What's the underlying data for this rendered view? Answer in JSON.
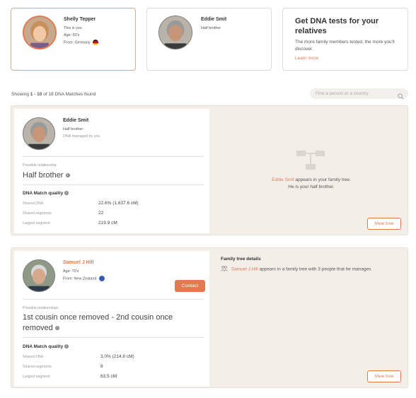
{
  "top_cards": {
    "me": {
      "name": "Shelly Tepper",
      "note": "This is you",
      "age": "Age: 50's",
      "from_label": "From:",
      "from_value": "Germany",
      "flag_icon": "germany-flag-icon"
    },
    "relative": {
      "name": "Eddie Smit",
      "relation": "Half brother"
    },
    "promo": {
      "title": "Get DNA tests for your relatives",
      "text": "The more family members tested, the more you'll discover.",
      "link": "Learn more"
    }
  },
  "results": {
    "showing_prefix": "Showing",
    "range": "1 - 10",
    "of_text": "of 18 DNA Matches found",
    "search_placeholder": "Find a person or a country"
  },
  "matches": [
    {
      "name": "Eddie Smit",
      "line1": "Half brother",
      "line2": "DNA managed by you",
      "relationship_label": "Possible relationship",
      "relationship": "Half brother",
      "quality_title": "DNA Match quality",
      "shared_dna_label": "Shared DNA",
      "shared_dna": "22.6% (1,637.6 cM)",
      "shared_segments_label": "Shared segments",
      "shared_segments": "22",
      "largest_segment_label": "Largest segment",
      "largest_segment": "219.9 cM",
      "tree_name": "Eddie Smit",
      "tree_text1": "appears in your family tree.",
      "tree_text2": "He is your half brother.",
      "view_tree": "View tree"
    },
    {
      "name": "Samuel J Hill",
      "age_label": "Age:",
      "age": "70's",
      "from_label": "From:",
      "from_value": "New Zealand",
      "contact": "Contact",
      "relationship_label": "Possible relationships",
      "relationship_line1": "1st cousin once removed - 2nd cousin once",
      "relationship_line2": "removed",
      "quality_title": "DNA Match quality",
      "shared_dna_label": "Shared DNA",
      "shared_dna": "3.0% (214.8 cM)",
      "shared_segments_label": "Shared segments",
      "shared_segments": "8",
      "largest_segment_label": "Largest segment",
      "largest_segment": "63.5 cM",
      "tree_details_title": "Family tree details",
      "tree_name": "Samuel J Hill",
      "tree_text": "appears in a family tree with 3 people that he manages",
      "view_tree": "View tree"
    }
  ],
  "colors": {
    "accent": "#e07a50",
    "panel_bg": "#f3efe8"
  }
}
